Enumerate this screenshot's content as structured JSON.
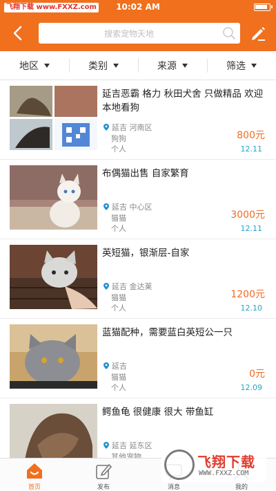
{
  "status_bar": {
    "carrier": "飞翔下载 www.FXXZ.com",
    "time": "10:02 AM"
  },
  "nav": {
    "search_placeholder": "搜索宠物天地"
  },
  "filters": [
    {
      "label": "地区"
    },
    {
      "label": "类别"
    },
    {
      "label": "来源"
    },
    {
      "label": "筛选"
    }
  ],
  "listings": [
    {
      "title": "延吉恶霸 格力 秋田犬舍 只做精品 欢迎本地看狗",
      "region": "延吉 河南区",
      "category": "狗狗",
      "seller": "个人",
      "price": "800元",
      "date": "12.11"
    },
    {
      "title": "布偶猫出售 自家繁育",
      "region": "延吉 中心区",
      "category": "猫猫",
      "seller": "个人",
      "price": "3000元",
      "date": "12.11"
    },
    {
      "title": "英短猫，银渐层-自家",
      "region": "延吉 金达莱",
      "category": "猫猫",
      "seller": "个人",
      "price": "1200元",
      "date": "12.10"
    },
    {
      "title": "蓝猫配种，需要蓝白英短公一只",
      "region": "延吉",
      "category": "猫猫",
      "seller": "个人",
      "price": "0元",
      "date": "12.09"
    },
    {
      "title": "鳄鱼龟 很健康 很大 带鱼缸",
      "region": "延吉 延东区",
      "category": "其他宠物",
      "seller": "",
      "price": "",
      "date": ""
    }
  ],
  "tabs": [
    {
      "label": "首页",
      "icon": "home-icon",
      "active": true
    },
    {
      "label": "发布",
      "icon": "publish-icon",
      "active": false
    },
    {
      "label": "消息",
      "icon": "message-icon",
      "active": false
    },
    {
      "label": "我的",
      "icon": "profile-icon",
      "active": false
    }
  ],
  "watermark": {
    "brand": "飞翔下载",
    "url": "WWW.FXXZ.COM"
  },
  "colors": {
    "accent": "#f0701e",
    "price": "#ee6b24",
    "date": "#22a3c8"
  }
}
